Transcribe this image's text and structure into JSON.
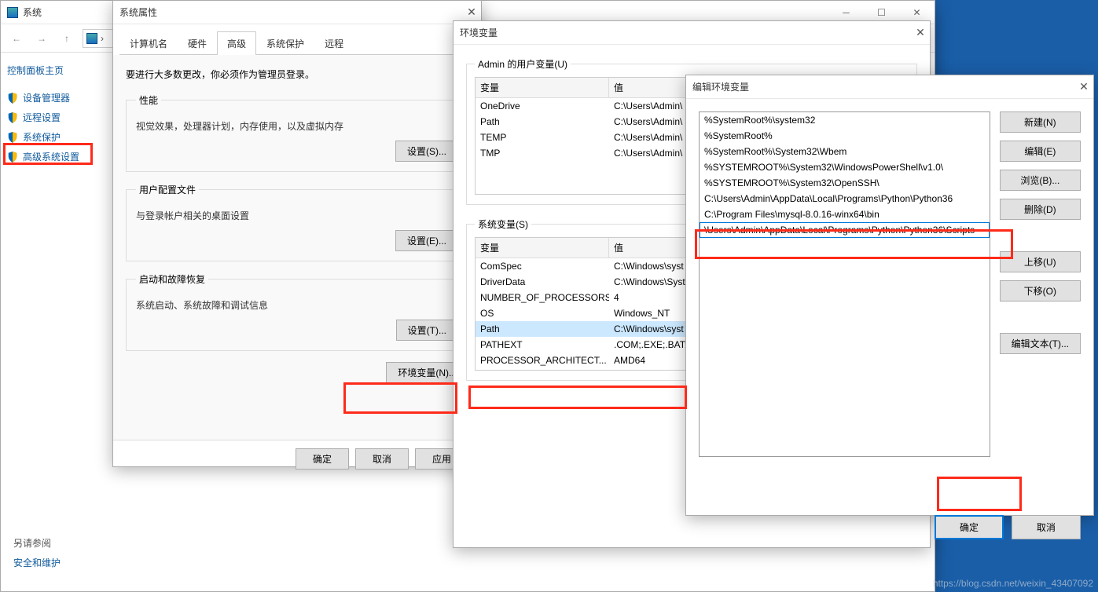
{
  "sys": {
    "title": "系统",
    "sidebar_header": "控制面板主页",
    "sidebar_items": [
      "设备管理器",
      "远程设置",
      "系统保护",
      "高级系统设置"
    ],
    "footer_head": "另请参阅",
    "footer_link": "安全和维护"
  },
  "props": {
    "title": "系统属性",
    "tabs": [
      "计算机名",
      "硬件",
      "高级",
      "系统保护",
      "远程"
    ],
    "active_tab": 2,
    "intro": "要进行大多数更改，你必须作为管理员登录。",
    "perf_legend": "性能",
    "perf_desc": "视觉效果，处理器计划，内存使用，以及虚拟内存",
    "perf_btn": "设置(S)...",
    "prof_legend": "用户配置文件",
    "prof_desc": "与登录帐户相关的桌面设置",
    "prof_btn": "设置(E)...",
    "start_legend": "启动和故障恢复",
    "start_desc": "系统启动、系统故障和调试信息",
    "start_btn": "设置(T)...",
    "env_btn": "环境变量(N)...",
    "ok": "确定",
    "cancel": "取消",
    "apply": "应用"
  },
  "env": {
    "title": "环境变量",
    "user_legend": "Admin 的用户变量(U)",
    "sys_legend": "系统变量(S)",
    "col_var": "变量",
    "col_val": "值",
    "user_rows": [
      {
        "v": "OneDrive",
        "val": "C:\\Users\\Admin\\"
      },
      {
        "v": "Path",
        "val": "C:\\Users\\Admin\\"
      },
      {
        "v": "TEMP",
        "val": "C:\\Users\\Admin\\"
      },
      {
        "v": "TMP",
        "val": "C:\\Users\\Admin\\"
      }
    ],
    "sys_rows": [
      {
        "v": "ComSpec",
        "val": "C:\\Windows\\syst"
      },
      {
        "v": "DriverData",
        "val": "C:\\Windows\\Syst"
      },
      {
        "v": "NUMBER_OF_PROCESSORS",
        "val": "4"
      },
      {
        "v": "OS",
        "val": "Windows_NT"
      },
      {
        "v": "Path",
        "val": "C:\\Windows\\syst"
      },
      {
        "v": "PATHEXT",
        "val": ".COM;.EXE;.BAT;."
      },
      {
        "v": "PROCESSOR_ARCHITECT...",
        "val": "AMD64"
      }
    ]
  },
  "edit": {
    "title": "编辑环境变量",
    "items": [
      "%SystemRoot%\\system32",
      "%SystemRoot%",
      "%SystemRoot%\\System32\\Wbem",
      "%SYSTEMROOT%\\System32\\WindowsPowerShell\\v1.0\\",
      "%SYSTEMROOT%\\System32\\OpenSSH\\",
      "C:\\Users\\Admin\\AppData\\Local\\Programs\\Python\\Python36",
      "C:\\Program Files\\mysql-8.0.16-winx64\\bin",
      "\\Users\\Admin\\AppData\\Local\\Programs\\Python\\Python36\\Scripts"
    ],
    "editing_index": 7,
    "btns": {
      "new": "新建(N)",
      "edit": "编辑(E)",
      "browse": "浏览(B)...",
      "del": "删除(D)",
      "up": "上移(U)",
      "down": "下移(O)",
      "edittext": "编辑文本(T)..."
    },
    "ok": "确定",
    "cancel": "取消"
  },
  "watermark": "https://blog.csdn.net/weixin_43407092"
}
